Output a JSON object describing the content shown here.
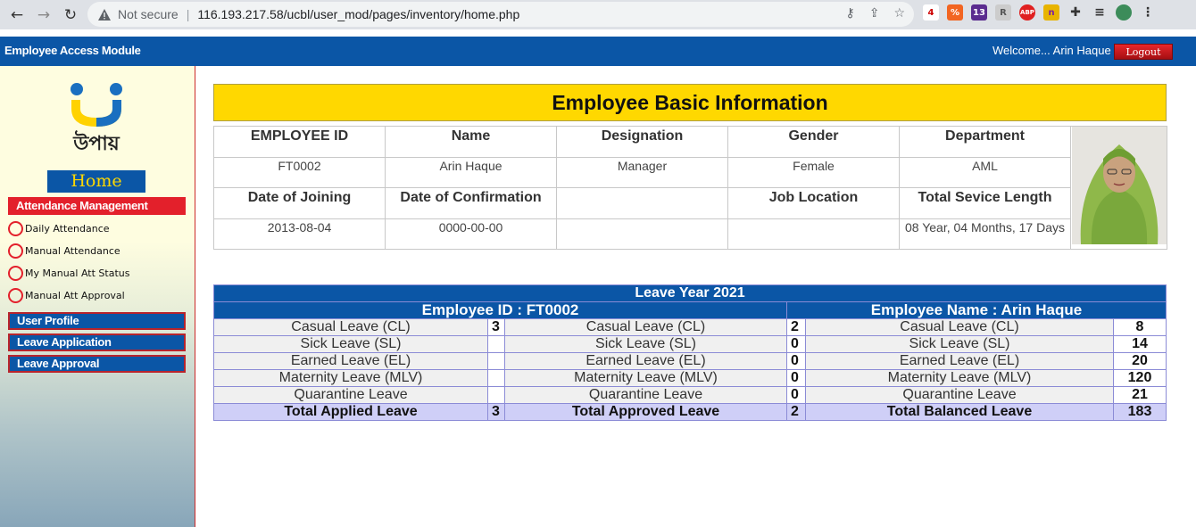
{
  "browser": {
    "not_secure": "Not secure",
    "separator": "|",
    "url": "116.193.217.58/ucbl/user_mod/pages/inventory/home.php"
  },
  "app": {
    "title": "Employee Access Module",
    "welcome": "Welcome... Arin Haque",
    "logout": "Logout",
    "logo_text": "উপায়"
  },
  "sidebar": {
    "home": "Home",
    "attendance_head": "Attendance Management",
    "attendance_items": [
      "Daily Attendance",
      "Manual Attendance",
      "My Manual Att Status",
      "Manual Att Approval"
    ],
    "user_profile": "User Profile",
    "leave_application": "Leave Application",
    "leave_approval": "Leave Approval"
  },
  "employee": {
    "banner": "Employee Basic Information",
    "headers1": [
      "EMPLOYEE ID",
      "Name",
      "Designation",
      "Gender",
      "Department"
    ],
    "values1": [
      "FT0002",
      "Arin Haque",
      "Manager",
      "Female",
      "AML"
    ],
    "headers2": [
      "Date of Joining",
      "Date of Confirmation",
      "",
      "Job Location",
      "Total Sevice Length"
    ],
    "values2": [
      "2013-08-04",
      "0000-00-00",
      "",
      "",
      "08 Year, 04 Months, 17 Days"
    ]
  },
  "leave": {
    "year_title": "Leave Year 2021",
    "emp_id_title": "Employee ID : FT0002",
    "emp_name_title": "Employee Name : Arin Haque",
    "rows": [
      {
        "applied_label": "Casual Leave (CL)",
        "applied": "3",
        "approved_label": "Casual Leave (CL)",
        "approved": "2",
        "balance_label": "Casual Leave (CL)",
        "balance": "8"
      },
      {
        "applied_label": "Sick Leave (SL)",
        "applied": "",
        "approved_label": "Sick Leave (SL)",
        "approved": "0",
        "balance_label": "Sick Leave (SL)",
        "balance": "14"
      },
      {
        "applied_label": "Earned Leave (EL)",
        "applied": "",
        "approved_label": "Earned Leave (EL)",
        "approved": "0",
        "balance_label": "Earned Leave (EL)",
        "balance": "20"
      },
      {
        "applied_label": "Maternity Leave (MLV)",
        "applied": "",
        "approved_label": "Maternity Leave (MLV)",
        "approved": "0",
        "balance_label": "Maternity Leave (MLV)",
        "balance": "120"
      },
      {
        "applied_label": "Quarantine Leave",
        "applied": "",
        "approved_label": "Quarantine Leave",
        "approved": "0",
        "balance_label": "Quarantine Leave",
        "balance": "21"
      }
    ],
    "totals": {
      "applied_label": "Total Applied Leave",
      "applied": "3",
      "approved_label": "Total Approved Leave",
      "approved": "2",
      "balance_label": "Total Balanced Leave",
      "balance": "183"
    }
  },
  "colors": {
    "header_blue": "#0b56a6",
    "banner_yellow": "#ffd800",
    "menu_red": "#e3202b"
  }
}
